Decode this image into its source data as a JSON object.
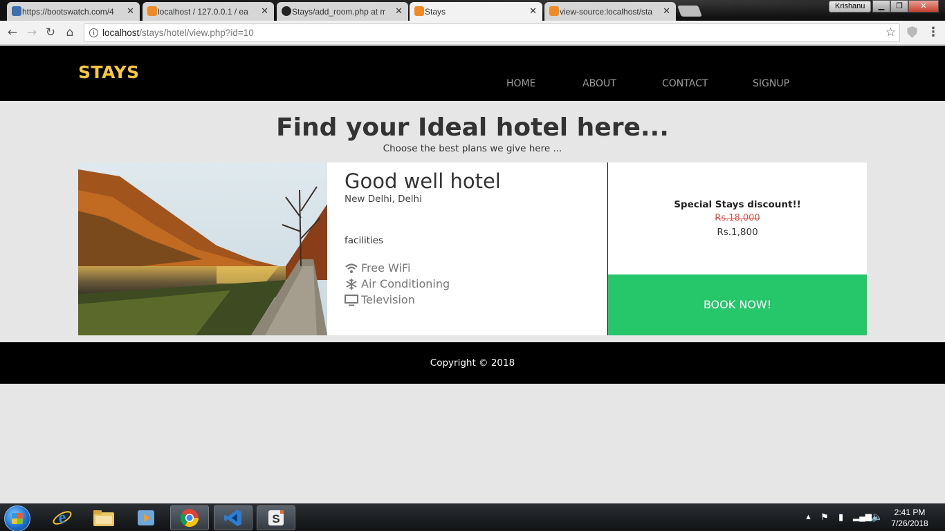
{
  "browser": {
    "tabs": [
      {
        "label": "https://bootswatch.com/4",
        "favicon_color": "#3a6fb0"
      },
      {
        "label": "localhost / 127.0.0.1 / ea",
        "favicon_color": "#f08a24"
      },
      {
        "label": "Stays/add_room.php at m",
        "favicon_color": "#222222"
      },
      {
        "label": "Stays",
        "favicon_color": "#f08a24"
      },
      {
        "label": "view-source:localhost/sta",
        "favicon_color": "#f08a24"
      }
    ],
    "active_tab": 3,
    "profile_name": "Krishanu",
    "url_host": "localhost",
    "url_path": "/stays/hotel/view.php?id=10"
  },
  "site": {
    "brand": "STAYS",
    "brand_color": "#f8c93a",
    "nav": [
      "HOME",
      "ABOUT",
      "CONTACT",
      "SIGNUP"
    ],
    "hero_title": "Find your Ideal hotel here...",
    "hero_subtitle": "Choose the best plans we give here ...",
    "hotel": {
      "name": "Good well hotel",
      "location": "New Delhi, Delhi",
      "facilities_heading": "facilities",
      "facilities": [
        {
          "icon": "wifi-icon",
          "label": "Free WiFi"
        },
        {
          "icon": "snowflake-icon",
          "label": "Air Conditioning"
        },
        {
          "icon": "television-icon",
          "label": "Television"
        }
      ]
    },
    "pricing": {
      "discount_label": "Special Stays discount!!",
      "old_price": "Rs.18,000",
      "new_price": "Rs.1,800",
      "book_button": "BOOK NOW!",
      "book_color": "#26c66a"
    },
    "footer": "Copyright © 2018"
  },
  "taskbar": {
    "time": "2:41 PM",
    "date": "7/26/2018"
  }
}
